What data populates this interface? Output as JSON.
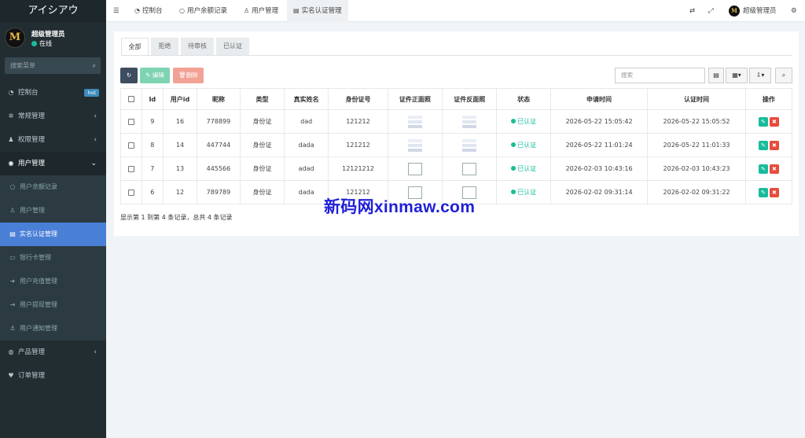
{
  "app": {
    "brand": "アイシアウ",
    "user_name": "超级管理员",
    "user_status": "在线",
    "avatar_letter": "M",
    "search_placeholder": "搜索菜单"
  },
  "sidebar": {
    "items": [
      {
        "label": "控制台",
        "icon": "dashboard-icon",
        "badge": "hot"
      },
      {
        "label": "常规管理",
        "icon": "gears-icon",
        "arrow": "‹"
      },
      {
        "label": "权限管理",
        "icon": "group-icon",
        "arrow": "‹"
      },
      {
        "label": "用户管理",
        "icon": "user-circle-icon",
        "arrow": "⌄"
      }
    ],
    "sub_items": [
      {
        "label": "用户余额记录",
        "icon": "circle-icon"
      },
      {
        "label": "用户管理",
        "icon": "user-icon"
      },
      {
        "label": "实名认证管理",
        "icon": "id-card-icon"
      },
      {
        "label": "银行卡管理",
        "icon": "credit-card-icon"
      },
      {
        "label": "用户充值管理",
        "icon": "sign-in-icon"
      },
      {
        "label": "用户提现管理",
        "icon": "sign-out-icon"
      },
      {
        "label": "用户通知管理",
        "icon": "anchor-icon"
      }
    ],
    "bottom_items": [
      {
        "label": "产品管理",
        "icon": "product-icon",
        "arrow": "‹"
      },
      {
        "label": "订单管理",
        "icon": "heartbeat-icon"
      }
    ]
  },
  "topbar": {
    "menu_icon": "☰",
    "tabs": [
      {
        "label": "控制台",
        "icon": "dashboard-icon"
      },
      {
        "label": "用户余额记录",
        "icon": "circle-icon"
      },
      {
        "label": "用户管理",
        "icon": "user-icon"
      },
      {
        "label": "实名认证管理",
        "icon": "id-card-icon"
      }
    ],
    "user_name": "超级管理员"
  },
  "filter_tabs": [
    "全部",
    "拒绝",
    "待审核",
    "已认证"
  ],
  "toolbar": {
    "edit_label": "编辑",
    "delete_label": "删除",
    "search_placeholder": "搜索"
  },
  "table": {
    "headers": [
      "Id",
      "用户id",
      "昵称",
      "类型",
      "真实姓名",
      "身份证号",
      "证件正面照",
      "证件反面照",
      "状态",
      "申请时间",
      "认证时间",
      "操作"
    ],
    "rows": [
      {
        "id": "9",
        "user_id": "16",
        "nickname": "778899",
        "type": "身份证",
        "real_name": "dad",
        "id_number": "121212",
        "front": "image",
        "back": "image",
        "status": "已认证",
        "apply_time": "2026-05-22 15:05:42",
        "auth_time": "2026-05-22 15:05:52"
      },
      {
        "id": "8",
        "user_id": "14",
        "nickname": "447744",
        "type": "身份证",
        "real_name": "dada",
        "id_number": "121212",
        "front": "image",
        "back": "image",
        "status": "已认证",
        "apply_time": "2026-05-22 11:01:24",
        "auth_time": "2026-05-22 11:01:33"
      },
      {
        "id": "7",
        "user_id": "13",
        "nickname": "445566",
        "type": "身份证",
        "real_name": "adad",
        "id_number": "12121212",
        "front": "broken",
        "back": "broken",
        "status": "已认证",
        "apply_time": "2026-02-03 10:43:16",
        "auth_time": "2026-02-03 10:43:23"
      },
      {
        "id": "6",
        "user_id": "12",
        "nickname": "789789",
        "type": "身份证",
        "real_name": "dada",
        "id_number": "121212",
        "front": "broken",
        "back": "broken",
        "status": "已认证",
        "apply_time": "2026-02-02 09:31:14",
        "auth_time": "2026-02-02 09:31:22"
      }
    ]
  },
  "pagination_info": "显示第 1 到第 4 条记录，总共 4 条记录",
  "watermark": "新码网xinmaw.com",
  "colors": {
    "sidebar": "#222d32",
    "active_menu": "#4a7fd6",
    "success": "#18bc9c",
    "danger": "#e74c3c"
  }
}
